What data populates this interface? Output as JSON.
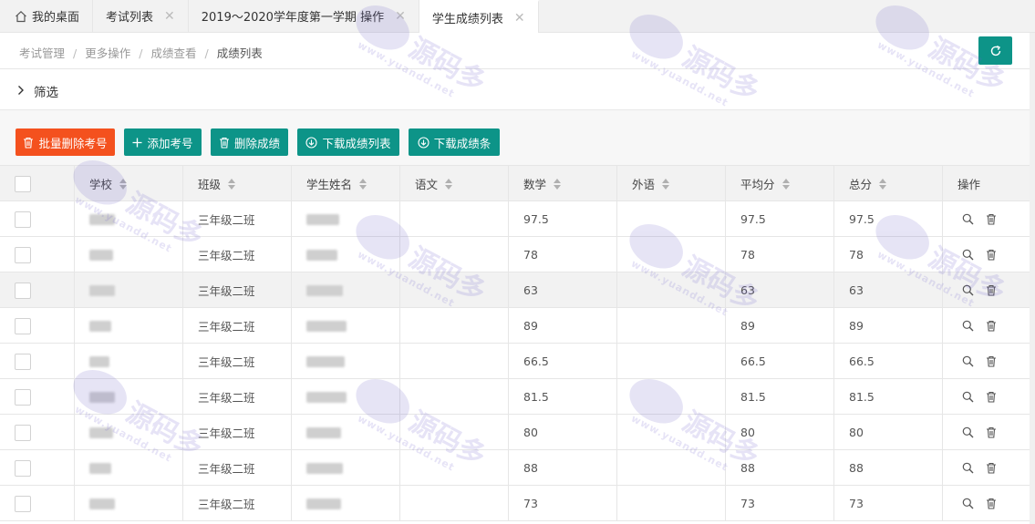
{
  "tabs": [
    {
      "label": "我的桌面",
      "closable": false,
      "active": false,
      "icon": "home-icon"
    },
    {
      "label": "考试列表",
      "closable": true,
      "active": false
    },
    {
      "label": "2019～2020学年度第一学期 操作",
      "closable": true,
      "active": false
    },
    {
      "label": "学生成绩列表",
      "closable": true,
      "active": true
    }
  ],
  "breadcrumb": [
    "考试管理",
    "更多操作",
    "成绩查看",
    "成绩列表"
  ],
  "filter": {
    "label": "筛选"
  },
  "buttons": {
    "batch_delete": "批量删除考号",
    "add_exam_no": "添加考号",
    "delete_score": "删除成绩",
    "download_list": "下载成绩列表",
    "download_slip": "下载成绩条"
  },
  "table": {
    "headers": [
      "学校",
      "班级",
      "学生姓名",
      "语文",
      "数学",
      "外语",
      "平均分",
      "总分",
      "操作"
    ],
    "rows": [
      {
        "class": "三年级二班",
        "chinese": "",
        "math": "97.5",
        "foreign": "",
        "avg": "97.5",
        "total": "97.5"
      },
      {
        "class": "三年级二班",
        "chinese": "",
        "math": "78",
        "foreign": "",
        "avg": "78",
        "total": "78"
      },
      {
        "class": "三年级二班",
        "chinese": "",
        "math": "63",
        "foreign": "",
        "avg": "63",
        "total": "63"
      },
      {
        "class": "三年级二班",
        "chinese": "",
        "math": "89",
        "foreign": "",
        "avg": "89",
        "total": "89"
      },
      {
        "class": "三年级二班",
        "chinese": "",
        "math": "66.5",
        "foreign": "",
        "avg": "66.5",
        "total": "66.5"
      },
      {
        "class": "三年级二班",
        "chinese": "",
        "math": "81.5",
        "foreign": "",
        "avg": "81.5",
        "total": "81.5"
      },
      {
        "class": "三年级二班",
        "chinese": "",
        "math": "80",
        "foreign": "",
        "avg": "80",
        "total": "80"
      },
      {
        "class": "三年级二班",
        "chinese": "",
        "math": "88",
        "foreign": "",
        "avg": "88",
        "total": "88"
      },
      {
        "class": "三年级二班",
        "chinese": "",
        "math": "73",
        "foreign": "",
        "avg": "73",
        "total": "73"
      }
    ]
  },
  "colors": {
    "accent": "#0d9488",
    "danger": "#f4511e"
  },
  "watermark": {
    "brand": "源码多",
    "url": "www.yuandd.net"
  }
}
